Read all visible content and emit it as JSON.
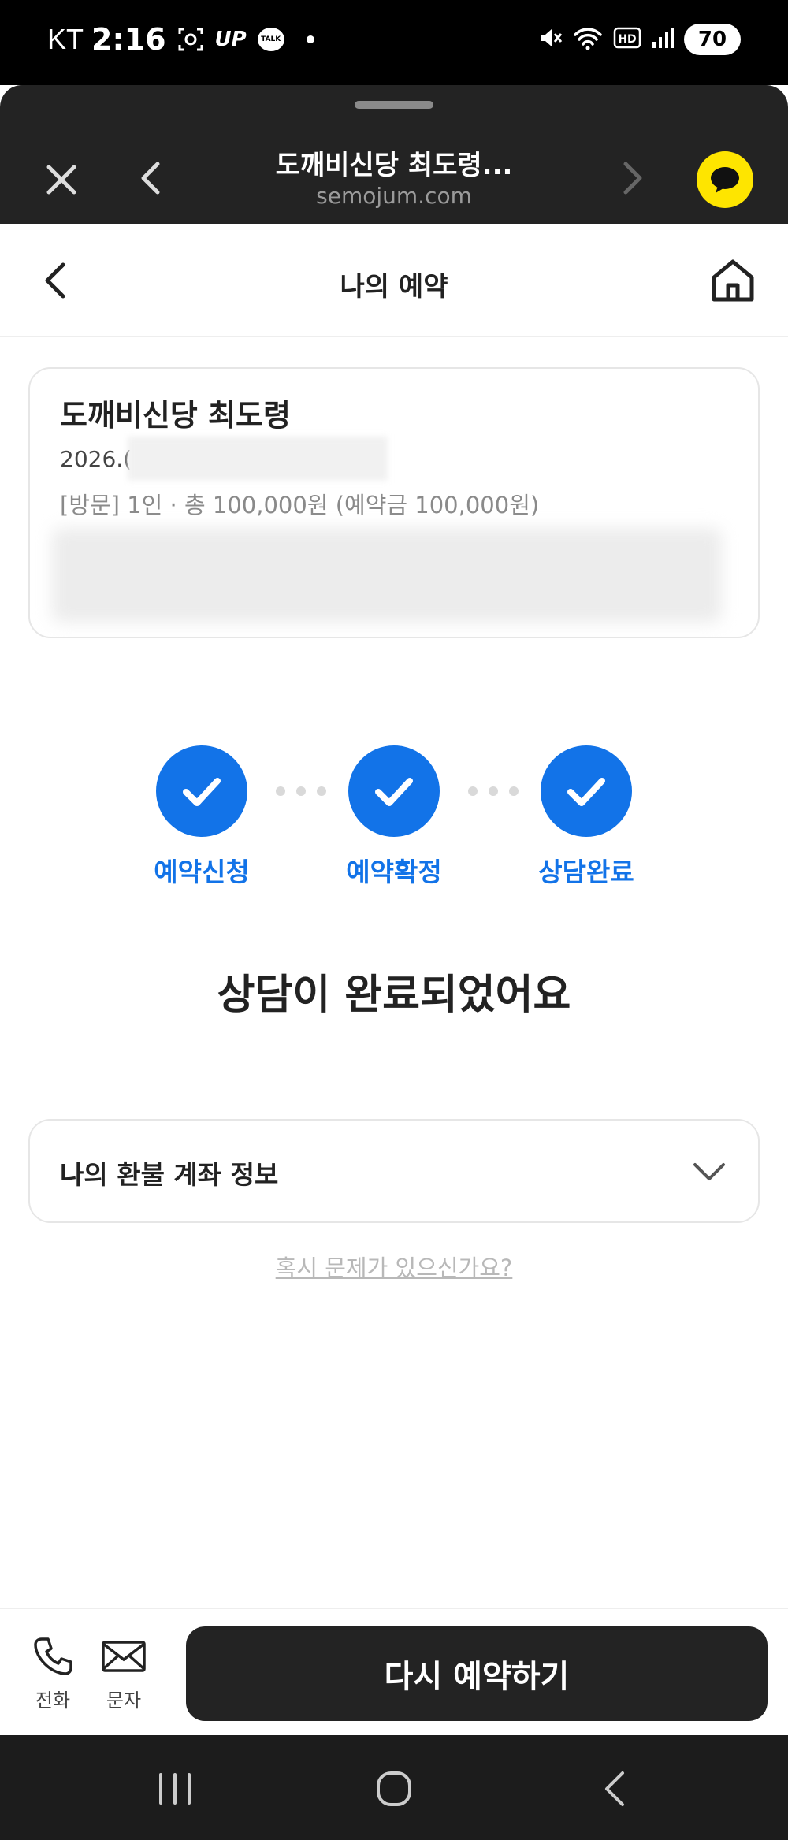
{
  "status_bar": {
    "carrier": "KT",
    "time": "2:16",
    "up_label": "UP",
    "talk_label": "TALK",
    "battery": "70"
  },
  "browser": {
    "title": "도깨비신당 최도령...",
    "url": "semojum.com"
  },
  "header": {
    "title": "나의 예약"
  },
  "reservation": {
    "shop_name": "도깨비신당 최도령",
    "date_partial": "2026.(",
    "detail": "[방문] 1인 · 총 100,000원 (예약금 100,000원)"
  },
  "steps": [
    {
      "label": "예약신청",
      "done": true
    },
    {
      "label": "예약확정",
      "done": true
    },
    {
      "label": "상담완료",
      "done": true
    }
  ],
  "status_message": "상담이 완료되었어요",
  "refund": {
    "label": "나의 환불 계좌 정보"
  },
  "problem_link": "혹시 문제가 있으신가요?",
  "bottom": {
    "phone_label": "전화",
    "message_label": "문자",
    "rebook_label": "다시 예약하기"
  },
  "colors": {
    "accent": "#1273e8",
    "kakao_yellow": "#fee500",
    "dark": "#232323"
  }
}
